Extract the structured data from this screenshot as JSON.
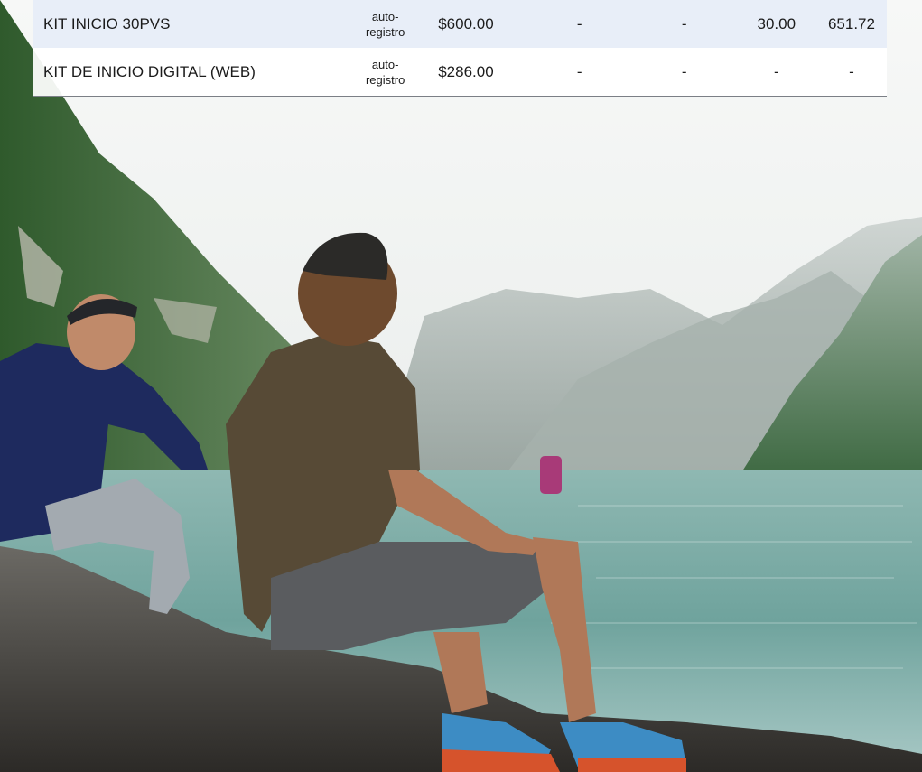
{
  "table": {
    "rows": [
      {
        "name": "KIT INICIO 30PVS",
        "registration_line1": "auto-",
        "registration_line2": "registro",
        "price": "$600.00",
        "col3": "-",
        "col4": "-",
        "col5": "30.00",
        "col6": "651.72"
      },
      {
        "name": "KIT DE INICIO DIGITAL (WEB)",
        "registration_line1": "auto-",
        "registration_line2": "registro",
        "price": "$286.00",
        "col3": "-",
        "col4": "-",
        "col5": "-",
        "col6": "-"
      }
    ]
  },
  "colors": {
    "row_highlight": "#e8eef8",
    "lake": "#6fa9a4",
    "sky": "#eef0ee"
  }
}
